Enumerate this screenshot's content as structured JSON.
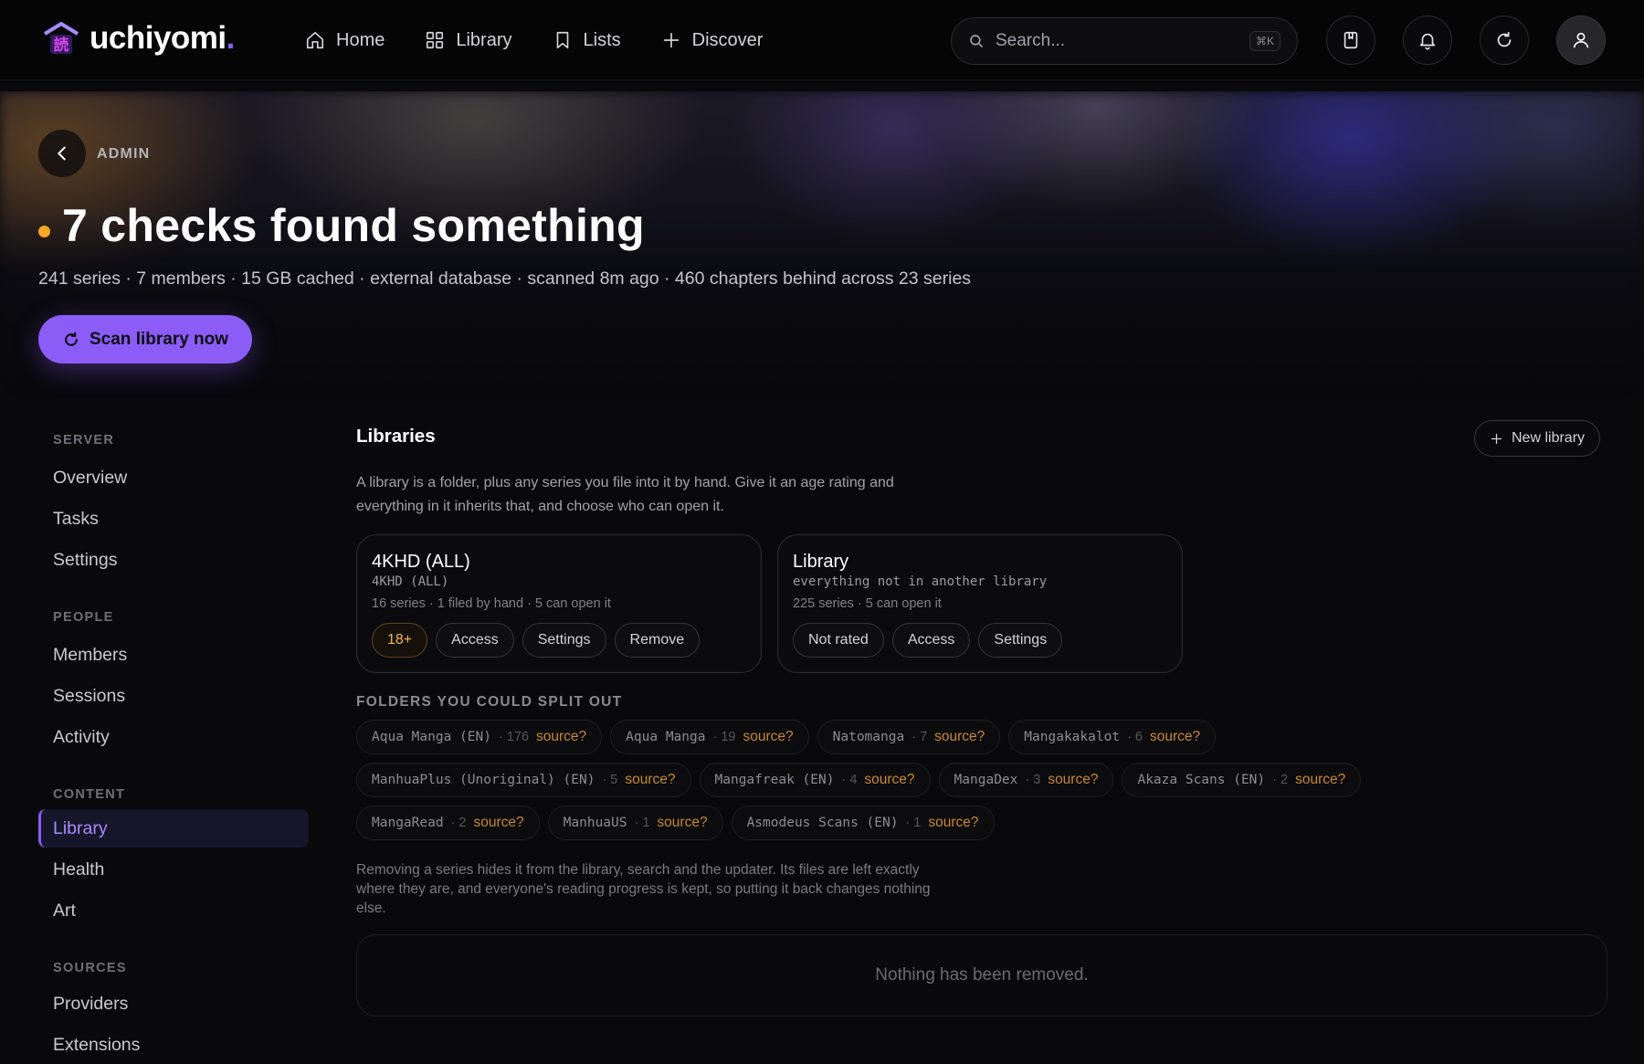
{
  "brand": {
    "name": "uchiyomi",
    "dot": "."
  },
  "nav": {
    "items": [
      {
        "label": "Home",
        "icon": "home-icon"
      },
      {
        "label": "Library",
        "icon": "grid-icon"
      },
      {
        "label": "Lists",
        "icon": "bookmark-icon"
      },
      {
        "label": "Discover",
        "icon": "plus-icon"
      }
    ]
  },
  "search": {
    "placeholder": "Search...",
    "shortcut": "⌘K"
  },
  "header_icons": [
    "book-bookmark-icon",
    "bell-icon",
    "refresh-icon",
    "user-icon"
  ],
  "hero": {
    "breadcrumb": "ADMIN",
    "title": "7 checks found something",
    "status_color": "#f5a623",
    "meta": "241 series · 7 members · 15 GB cached · external database · scanned 8m ago · 460 chapters behind across 23 series",
    "scan_button": "Scan library now"
  },
  "sidebar": {
    "sections": [
      {
        "title": "SERVER",
        "items": [
          "Overview",
          "Tasks",
          "Settings"
        ]
      },
      {
        "title": "PEOPLE",
        "items": [
          "Members",
          "Sessions",
          "Activity"
        ]
      },
      {
        "title": "CONTENT",
        "items": [
          "Library",
          "Health",
          "Art"
        ]
      },
      {
        "title": "SOURCES",
        "items": [
          "Providers",
          "Extensions"
        ]
      }
    ],
    "active": "Library"
  },
  "libraries": {
    "title": "Libraries",
    "new_button": "New library",
    "description": "A library is a folder, plus any series you file into it by hand. Give it an age rating and everything in it inherits that, and choose who can open it.",
    "cards": [
      {
        "name": "4KHD (ALL)",
        "sub": "4KHD (ALL)",
        "stat": "16 series · 1 filed by hand · 5 can open it",
        "rating": "18+",
        "buttons": [
          "Access",
          "Settings",
          "Remove"
        ]
      },
      {
        "name": "Library",
        "sub": "everything not in another library",
        "stat": "225 series · 5 can open it",
        "rating": "Not rated",
        "buttons": [
          "Access",
          "Settings"
        ]
      }
    ]
  },
  "folders": {
    "title": "FOLDERS YOU COULD SPLIT OUT",
    "source_label": "source?",
    "rows": [
      [
        {
          "name": "Aqua Manga (EN)",
          "count": "· 176"
        },
        {
          "name": "Aqua Manga",
          "count": "· 19"
        },
        {
          "name": "Natomanga",
          "count": "· 7"
        },
        {
          "name": "Mangakakalot",
          "count": "· 6"
        }
      ],
      [
        {
          "name": "ManhuaPlus (Unoriginal) (EN)",
          "count": "· 5"
        },
        {
          "name": "Mangafreak (EN)",
          "count": "· 4"
        },
        {
          "name": "MangaDex",
          "count": "· 3"
        },
        {
          "name": "Akaza Scans (EN)",
          "count": "· 2"
        }
      ],
      [
        {
          "name": "MangaRead",
          "count": "· 2"
        },
        {
          "name": "ManhuaUS",
          "count": "· 1"
        },
        {
          "name": "Asmodeus Scans (EN)",
          "count": "· 1"
        }
      ]
    ]
  },
  "removed": {
    "note": "Removing a series hides it from the library, search and the updater. Its files are left exactly where they are, and everyone's reading progress is kept, so putting it back changes nothing else.",
    "empty": "Nothing has been removed."
  },
  "colors": {
    "accent": "#8b5cf6",
    "warning": "#f5a623",
    "source_link": "#c9892a"
  }
}
